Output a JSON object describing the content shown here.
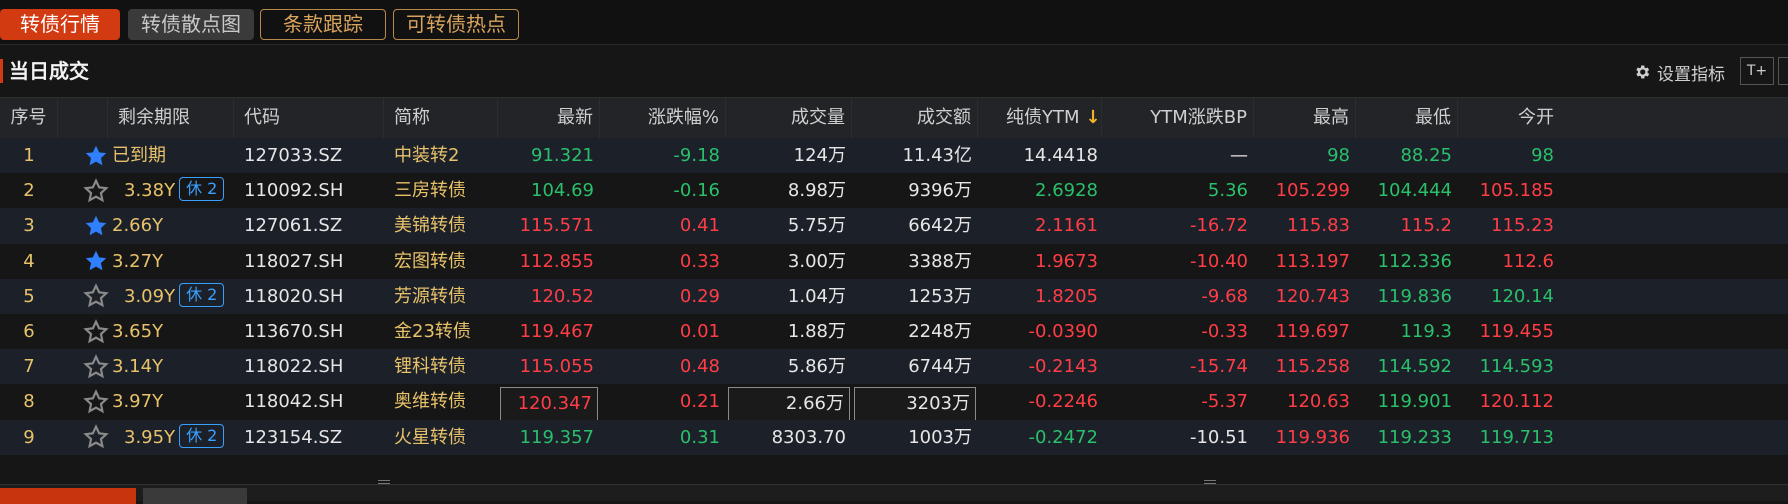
{
  "tabs": [
    {
      "label": "转债行情",
      "active": true
    },
    {
      "label": "转债散点图"
    },
    {
      "label": "条款跟踪"
    },
    {
      "label": "可转债热点"
    }
  ],
  "section": {
    "title": "当日成交",
    "settings_label": "设置指标",
    "tplus_label": "T+"
  },
  "table": {
    "headers": {
      "seq": "序号",
      "fav": "",
      "term": "剩余期限",
      "code": "代码",
      "name": "简称",
      "latest": "最新",
      "change_pct": "涨跌幅%",
      "volume": "成交量",
      "amount": "成交额",
      "ytm": "纯债YTM",
      "ytm_bp": "YTM涨跌BP",
      "high": "最高",
      "low": "最低",
      "open": "今开"
    },
    "sort_indicator": "↓",
    "rows": [
      {
        "seq": "1",
        "fav": true,
        "term": "已到期",
        "rest": "",
        "code": "127033.SZ",
        "name": "中装转2",
        "latest": "91.321",
        "change_pct": "-9.18",
        "volume": "124万",
        "amount": "11.43亿",
        "ytm": "14.4418",
        "ytm_bp": "—",
        "high": "98",
        "low": "88.25",
        "open": "98",
        "colors": {
          "latest": "green",
          "change_pct": "green",
          "ytm": "white",
          "ytm_bp": "white",
          "high": "green",
          "low": "green",
          "open": "green"
        }
      },
      {
        "seq": "2",
        "fav": false,
        "term": "3.38Y",
        "rest": "休 2",
        "code": "110092.SH",
        "name": "三房转债",
        "latest": "104.69",
        "change_pct": "-0.16",
        "volume": "8.98万",
        "amount": "9396万",
        "ytm": "2.6928",
        "ytm_bp": "5.36",
        "high": "105.299",
        "low": "104.444",
        "open": "105.185",
        "colors": {
          "latest": "green",
          "change_pct": "green",
          "ytm": "green",
          "ytm_bp": "green",
          "high": "red",
          "low": "green",
          "open": "red"
        }
      },
      {
        "seq": "3",
        "fav": true,
        "term": "2.66Y",
        "rest": "",
        "code": "127061.SZ",
        "name": "美锦转债",
        "latest": "115.571",
        "change_pct": "0.41",
        "volume": "5.75万",
        "amount": "6642万",
        "ytm": "2.1161",
        "ytm_bp": "-16.72",
        "high": "115.83",
        "low": "115.2",
        "open": "115.23",
        "colors": {
          "latest": "red",
          "change_pct": "red",
          "ytm": "red",
          "ytm_bp": "red",
          "high": "red",
          "low": "red",
          "open": "red"
        }
      },
      {
        "seq": "4",
        "fav": true,
        "term": "3.27Y",
        "rest": "",
        "code": "118027.SH",
        "name": "宏图转债",
        "latest": "112.855",
        "change_pct": "0.33",
        "volume": "3.00万",
        "amount": "3388万",
        "ytm": "1.9673",
        "ytm_bp": "-10.40",
        "high": "113.197",
        "low": "112.336",
        "open": "112.6",
        "colors": {
          "latest": "red",
          "change_pct": "red",
          "ytm": "red",
          "ytm_bp": "red",
          "high": "red",
          "low": "green",
          "open": "red"
        }
      },
      {
        "seq": "5",
        "fav": false,
        "term": "3.09Y",
        "rest": "休 2",
        "code": "118020.SH",
        "name": "芳源转债",
        "latest": "120.52",
        "change_pct": "0.29",
        "volume": "1.04万",
        "amount": "1253万",
        "ytm": "1.8205",
        "ytm_bp": "-9.68",
        "high": "120.743",
        "low": "119.836",
        "open": "120.14",
        "colors": {
          "latest": "red",
          "change_pct": "red",
          "ytm": "red",
          "ytm_bp": "red",
          "high": "red",
          "low": "green",
          "open": "green"
        }
      },
      {
        "seq": "6",
        "fav": false,
        "term": "3.65Y",
        "rest": "",
        "code": "113670.SH",
        "name": "金23转债",
        "latest": "119.467",
        "change_pct": "0.01",
        "volume": "1.88万",
        "amount": "2248万",
        "ytm": "-0.0390",
        "ytm_bp": "-0.33",
        "high": "119.697",
        "low": "119.3",
        "open": "119.455",
        "colors": {
          "latest": "red",
          "change_pct": "red",
          "ytm": "red",
          "ytm_bp": "red",
          "high": "red",
          "low": "green",
          "open": "red"
        }
      },
      {
        "seq": "7",
        "fav": false,
        "term": "3.14Y",
        "rest": "",
        "code": "118022.SH",
        "name": "锂科转债",
        "latest": "115.055",
        "change_pct": "0.48",
        "volume": "5.86万",
        "amount": "6744万",
        "ytm": "-0.2143",
        "ytm_bp": "-15.74",
        "high": "115.258",
        "low": "114.592",
        "open": "114.593",
        "colors": {
          "latest": "red",
          "change_pct": "red",
          "ytm": "red",
          "ytm_bp": "red",
          "high": "red",
          "low": "green",
          "open": "green"
        }
      },
      {
        "seq": "8",
        "fav": false,
        "term": "3.97Y",
        "rest": "",
        "code": "118042.SH",
        "name": "奥维转债",
        "latest": "120.347",
        "change_pct": "0.21",
        "volume": "2.66万",
        "amount": "3203万",
        "ytm": "-0.2246",
        "ytm_bp": "-5.37",
        "high": "120.63",
        "low": "119.901",
        "open": "120.112",
        "colors": {
          "latest": "red",
          "change_pct": "red",
          "ytm": "red",
          "ytm_bp": "red",
          "high": "red",
          "low": "green",
          "open": "red"
        },
        "boxed": [
          "latest",
          "volume",
          "amount"
        ]
      },
      {
        "seq": "9",
        "fav": false,
        "term": "3.95Y",
        "rest": "休 2",
        "code": "123154.SZ",
        "name": "火星转债",
        "latest": "119.357",
        "change_pct": "0.31",
        "volume": "8303.70",
        "amount": "1003万",
        "ytm": "-0.2472",
        "ytm_bp": "-10.51",
        "high": "119.936",
        "low": "119.233",
        "open": "119.713",
        "colors": {
          "latest": "green",
          "change_pct": "green",
          "ytm": "green",
          "ytm_bp": "white",
          "high": "red",
          "low": "green",
          "open": "green"
        }
      }
    ]
  },
  "colors": {
    "up": "#ff3d47",
    "down": "#2ac06b",
    "accent": "#d23a12",
    "star_on": "#2f7fff",
    "star_off": "#8a8a8a",
    "term_text": "#e8c26a",
    "badge": "#3aa0ff"
  }
}
